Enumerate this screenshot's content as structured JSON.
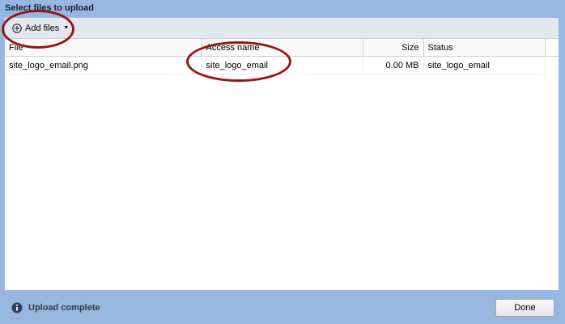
{
  "dialog": {
    "title": "Select files to upload"
  },
  "toolbar": {
    "add_files_label": "Add files",
    "add_files_icon": "plus-circle-icon"
  },
  "grid": {
    "columns": [
      {
        "key": "file",
        "label": "File"
      },
      {
        "key": "access_name",
        "label": "Access name"
      },
      {
        "key": "size",
        "label": "Size"
      },
      {
        "key": "status",
        "label": "Status"
      }
    ],
    "rows": [
      {
        "file": "site_logo_email.png",
        "access_name": "site_logo_email",
        "size": "0.00 MB",
        "status": "site_logo_email"
      }
    ]
  },
  "status_bar": {
    "icon": "info-icon",
    "message": "Upload complete"
  },
  "footer": {
    "done_label": "Done"
  },
  "annotations": {
    "color": "#9a1414",
    "highlighted": [
      "add-files-button",
      "column-access-name"
    ]
  }
}
